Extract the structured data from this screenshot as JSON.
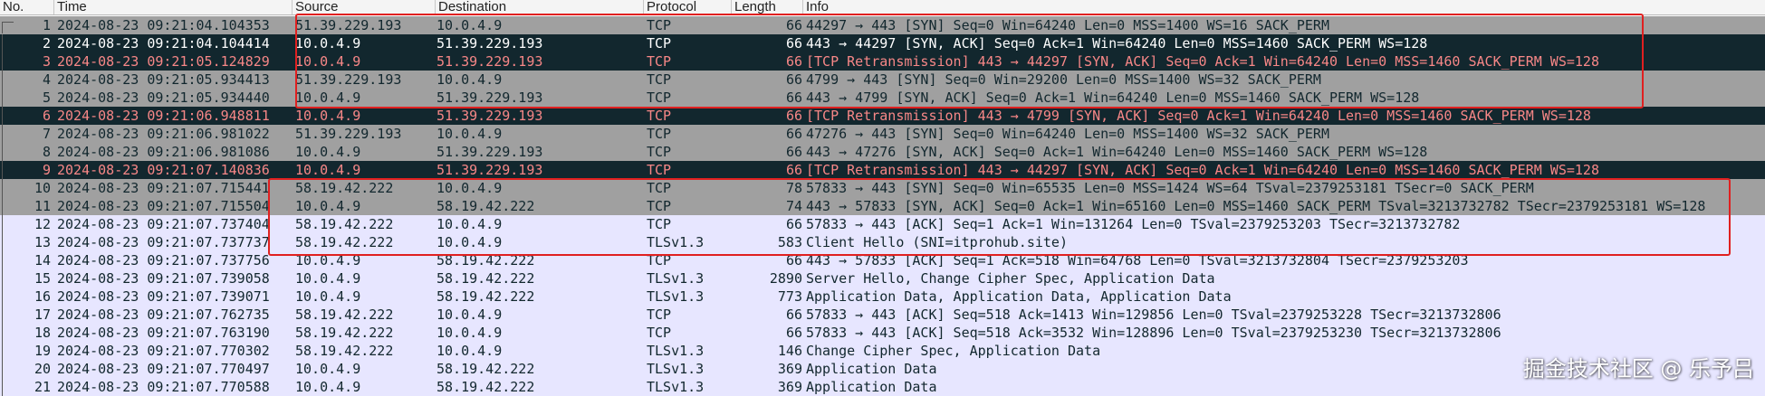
{
  "columns": {
    "no": "No.",
    "time": "Time",
    "source": "Source",
    "destination": "Destination",
    "protocol": "Protocol",
    "length": "Length",
    "info": "Info"
  },
  "row_colors": {
    "gray": {
      "bg": "#a0a0a0",
      "fg": "#12272e"
    },
    "black": {
      "bg": "#12272e",
      "fg": "#ffffff"
    },
    "retrans": {
      "bg": "#12272e",
      "fg": "#f78787"
    },
    "lavender": {
      "bg": "#e7e6ff",
      "fg": "#12272e"
    }
  },
  "packets": [
    {
      "no": "1",
      "time": "2024-08-23 09:21:04.104353",
      "source": "51.39.229.193",
      "destination": "10.0.4.9",
      "protocol": "TCP",
      "length": "66",
      "info": "44297 → 443 [SYN] Seq=0 Win=64240 Len=0 MSS=1400 WS=16 SACK_PERM",
      "style": "gray"
    },
    {
      "no": "2",
      "time": "2024-08-23 09:21:04.104414",
      "source": "10.0.4.9",
      "destination": "51.39.229.193",
      "protocol": "TCP",
      "length": "66",
      "info": "443 → 44297 [SYN, ACK] Seq=0 Ack=1 Win=64240 Len=0 MSS=1460 SACK_PERM WS=128",
      "style": "black"
    },
    {
      "no": "3",
      "time": "2024-08-23 09:21:05.124829",
      "source": "10.0.4.9",
      "destination": "51.39.229.193",
      "protocol": "TCP",
      "length": "66",
      "info": "[TCP Retransmission] 443 → 44297 [SYN, ACK] Seq=0 Ack=1 Win=64240 Len=0 MSS=1460 SACK_PERM WS=128",
      "style": "retrans"
    },
    {
      "no": "4",
      "time": "2024-08-23 09:21:05.934413",
      "source": "51.39.229.193",
      "destination": "10.0.4.9",
      "protocol": "TCP",
      "length": "66",
      "info": "4799 → 443 [SYN] Seq=0 Win=29200 Len=0 MSS=1400 WS=32 SACK_PERM",
      "style": "gray"
    },
    {
      "no": "5",
      "time": "2024-08-23 09:21:05.934440",
      "source": "10.0.4.9",
      "destination": "51.39.229.193",
      "protocol": "TCP",
      "length": "66",
      "info": "443 → 4799 [SYN, ACK] Seq=0 Ack=1 Win=64240 Len=0 MSS=1460 SACK_PERM WS=128",
      "style": "gray"
    },
    {
      "no": "6",
      "time": "2024-08-23 09:21:06.948811",
      "source": "10.0.4.9",
      "destination": "51.39.229.193",
      "protocol": "TCP",
      "length": "66",
      "info": "[TCP Retransmission] 443 → 4799 [SYN, ACK] Seq=0 Ack=1 Win=64240 Len=0 MSS=1460 SACK_PERM WS=128",
      "style": "retrans"
    },
    {
      "no": "7",
      "time": "2024-08-23 09:21:06.981022",
      "source": "51.39.229.193",
      "destination": "10.0.4.9",
      "protocol": "TCP",
      "length": "66",
      "info": "47276 → 443 [SYN] Seq=0 Win=64240 Len=0 MSS=1400 WS=32 SACK_PERM",
      "style": "gray"
    },
    {
      "no": "8",
      "time": "2024-08-23 09:21:06.981086",
      "source": "10.0.4.9",
      "destination": "51.39.229.193",
      "protocol": "TCP",
      "length": "66",
      "info": "443 → 47276 [SYN, ACK] Seq=0 Ack=1 Win=64240 Len=0 MSS=1460 SACK_PERM WS=128",
      "style": "gray"
    },
    {
      "no": "9",
      "time": "2024-08-23 09:21:07.140836",
      "source": "10.0.4.9",
      "destination": "51.39.229.193",
      "protocol": "TCP",
      "length": "66",
      "info": "[TCP Retransmission] 443 → 44297 [SYN, ACK] Seq=0 Ack=1 Win=64240 Len=0 MSS=1460 SACK_PERM WS=128",
      "style": "retrans"
    },
    {
      "no": "10",
      "time": "2024-08-23 09:21:07.715441",
      "source": "58.19.42.222",
      "destination": "10.0.4.9",
      "protocol": "TCP",
      "length": "78",
      "info": "57833 → 443 [SYN] Seq=0 Win=65535 Len=0 MSS=1424 WS=64 TSval=2379253181 TSecr=0 SACK_PERM",
      "style": "gray"
    },
    {
      "no": "11",
      "time": "2024-08-23 09:21:07.715504",
      "source": "10.0.4.9",
      "destination": "58.19.42.222",
      "protocol": "TCP",
      "length": "74",
      "info": "443 → 57833 [SYN, ACK] Seq=0 Ack=1 Win=65160 Len=0 MSS=1460 SACK_PERM TSval=3213732782 TSecr=2379253181 WS=128",
      "style": "gray"
    },
    {
      "no": "12",
      "time": "2024-08-23 09:21:07.737404",
      "source": "58.19.42.222",
      "destination": "10.0.4.9",
      "protocol": "TCP",
      "length": "66",
      "info": "57833 → 443 [ACK] Seq=1 Ack=1 Win=131264 Len=0 TSval=2379253203 TSecr=3213732782",
      "style": "lavender"
    },
    {
      "no": "13",
      "time": "2024-08-23 09:21:07.737737",
      "source": "58.19.42.222",
      "destination": "10.0.4.9",
      "protocol": "TLSv1.3",
      "length": "583",
      "info": "Client Hello (SNI=itprohub.site)",
      "style": "lavender"
    },
    {
      "no": "14",
      "time": "2024-08-23 09:21:07.737756",
      "source": "10.0.4.9",
      "destination": "58.19.42.222",
      "protocol": "TCP",
      "length": "66",
      "info": "443 → 57833 [ACK] Seq=1 Ack=518 Win=64768 Len=0 TSval=3213732804 TSecr=2379253203",
      "style": "lavender"
    },
    {
      "no": "15",
      "time": "2024-08-23 09:21:07.739058",
      "source": "10.0.4.9",
      "destination": "58.19.42.222",
      "protocol": "TLSv1.3",
      "length": "2890",
      "info": "Server Hello, Change Cipher Spec, Application Data",
      "style": "lavender"
    },
    {
      "no": "16",
      "time": "2024-08-23 09:21:07.739071",
      "source": "10.0.4.9",
      "destination": "58.19.42.222",
      "protocol": "TLSv1.3",
      "length": "773",
      "info": "Application Data, Application Data, Application Data",
      "style": "lavender"
    },
    {
      "no": "17",
      "time": "2024-08-23 09:21:07.762735",
      "source": "58.19.42.222",
      "destination": "10.0.4.9",
      "protocol": "TCP",
      "length": "66",
      "info": "57833 → 443 [ACK] Seq=518 Ack=1413 Win=129856 Len=0 TSval=2379253228 TSecr=3213732806",
      "style": "lavender"
    },
    {
      "no": "18",
      "time": "2024-08-23 09:21:07.763190",
      "source": "58.19.42.222",
      "destination": "10.0.4.9",
      "protocol": "TCP",
      "length": "66",
      "info": "57833 → 443 [ACK] Seq=518 Ack=3532 Win=128896 Len=0 TSval=2379253230 TSecr=3213732806",
      "style": "lavender"
    },
    {
      "no": "19",
      "time": "2024-08-23 09:21:07.770302",
      "source": "58.19.42.222",
      "destination": "10.0.4.9",
      "protocol": "TLSv1.3",
      "length": "146",
      "info": "Change Cipher Spec, Application Data",
      "style": "lavender"
    },
    {
      "no": "20",
      "time": "2024-08-23 09:21:07.770497",
      "source": "10.0.4.9",
      "destination": "58.19.42.222",
      "protocol": "TLSv1.3",
      "length": "369",
      "info": "Application Data",
      "style": "lavender"
    },
    {
      "no": "21",
      "time": "2024-08-23 09:21:07.770588",
      "source": "10.0.4.9",
      "destination": "58.19.42.222",
      "protocol": "TLSv1.3",
      "length": "369",
      "info": "Application Data",
      "style": "lavender"
    }
  ],
  "annotation_color": "#e02020",
  "watermark": "掘金技术社区 @ 乐予吕"
}
